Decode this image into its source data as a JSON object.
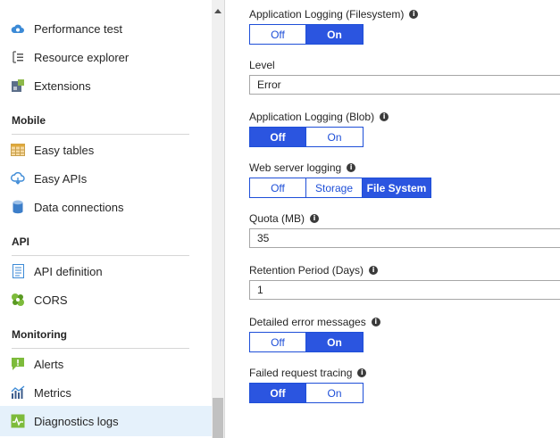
{
  "sidebar": {
    "items": [
      {
        "label": "Performance test",
        "icon": "cloud-icon"
      },
      {
        "label": "Resource explorer",
        "icon": "resource-explorer-icon"
      },
      {
        "label": "Extensions",
        "icon": "extensions-icon"
      }
    ],
    "sections": [
      {
        "header": "Mobile",
        "items": [
          {
            "label": "Easy tables",
            "icon": "table-icon"
          },
          {
            "label": "Easy APIs",
            "icon": "cloud-api-icon"
          },
          {
            "label": "Data connections",
            "icon": "database-icon"
          }
        ]
      },
      {
        "header": "API",
        "items": [
          {
            "label": "API definition",
            "icon": "document-icon"
          },
          {
            "label": "CORS",
            "icon": "cors-icon"
          }
        ]
      },
      {
        "header": "Monitoring",
        "items": [
          {
            "label": "Alerts",
            "icon": "alert-icon"
          },
          {
            "label": "Metrics",
            "icon": "metrics-icon"
          },
          {
            "label": "Diagnostics logs",
            "icon": "diagnostics-icon",
            "selected": true
          }
        ]
      }
    ]
  },
  "settings": {
    "app_logging_fs": {
      "label": "Application Logging (Filesystem)",
      "options": [
        "Off",
        "On"
      ],
      "selected": "On"
    },
    "level": {
      "label": "Level",
      "value": "Error"
    },
    "app_logging_blob": {
      "label": "Application Logging (Blob)",
      "options": [
        "Off",
        "On"
      ],
      "selected": "Off"
    },
    "web_server_logging": {
      "label": "Web server logging",
      "options": [
        "Off",
        "Storage",
        "File System"
      ],
      "selected": "File System"
    },
    "quota": {
      "label": "Quota (MB)",
      "value": "35"
    },
    "retention": {
      "label": "Retention Period (Days)",
      "value": "1"
    },
    "detailed_errors": {
      "label": "Detailed error messages",
      "options": [
        "Off",
        "On"
      ],
      "selected": "On"
    },
    "failed_request_tracing": {
      "label": "Failed request tracing",
      "options": [
        "Off",
        "On"
      ],
      "selected": "Off"
    }
  },
  "info_glyph": "i",
  "colors": {
    "accent": "#2b55e0",
    "selected_nav": "#e5f1fb"
  }
}
